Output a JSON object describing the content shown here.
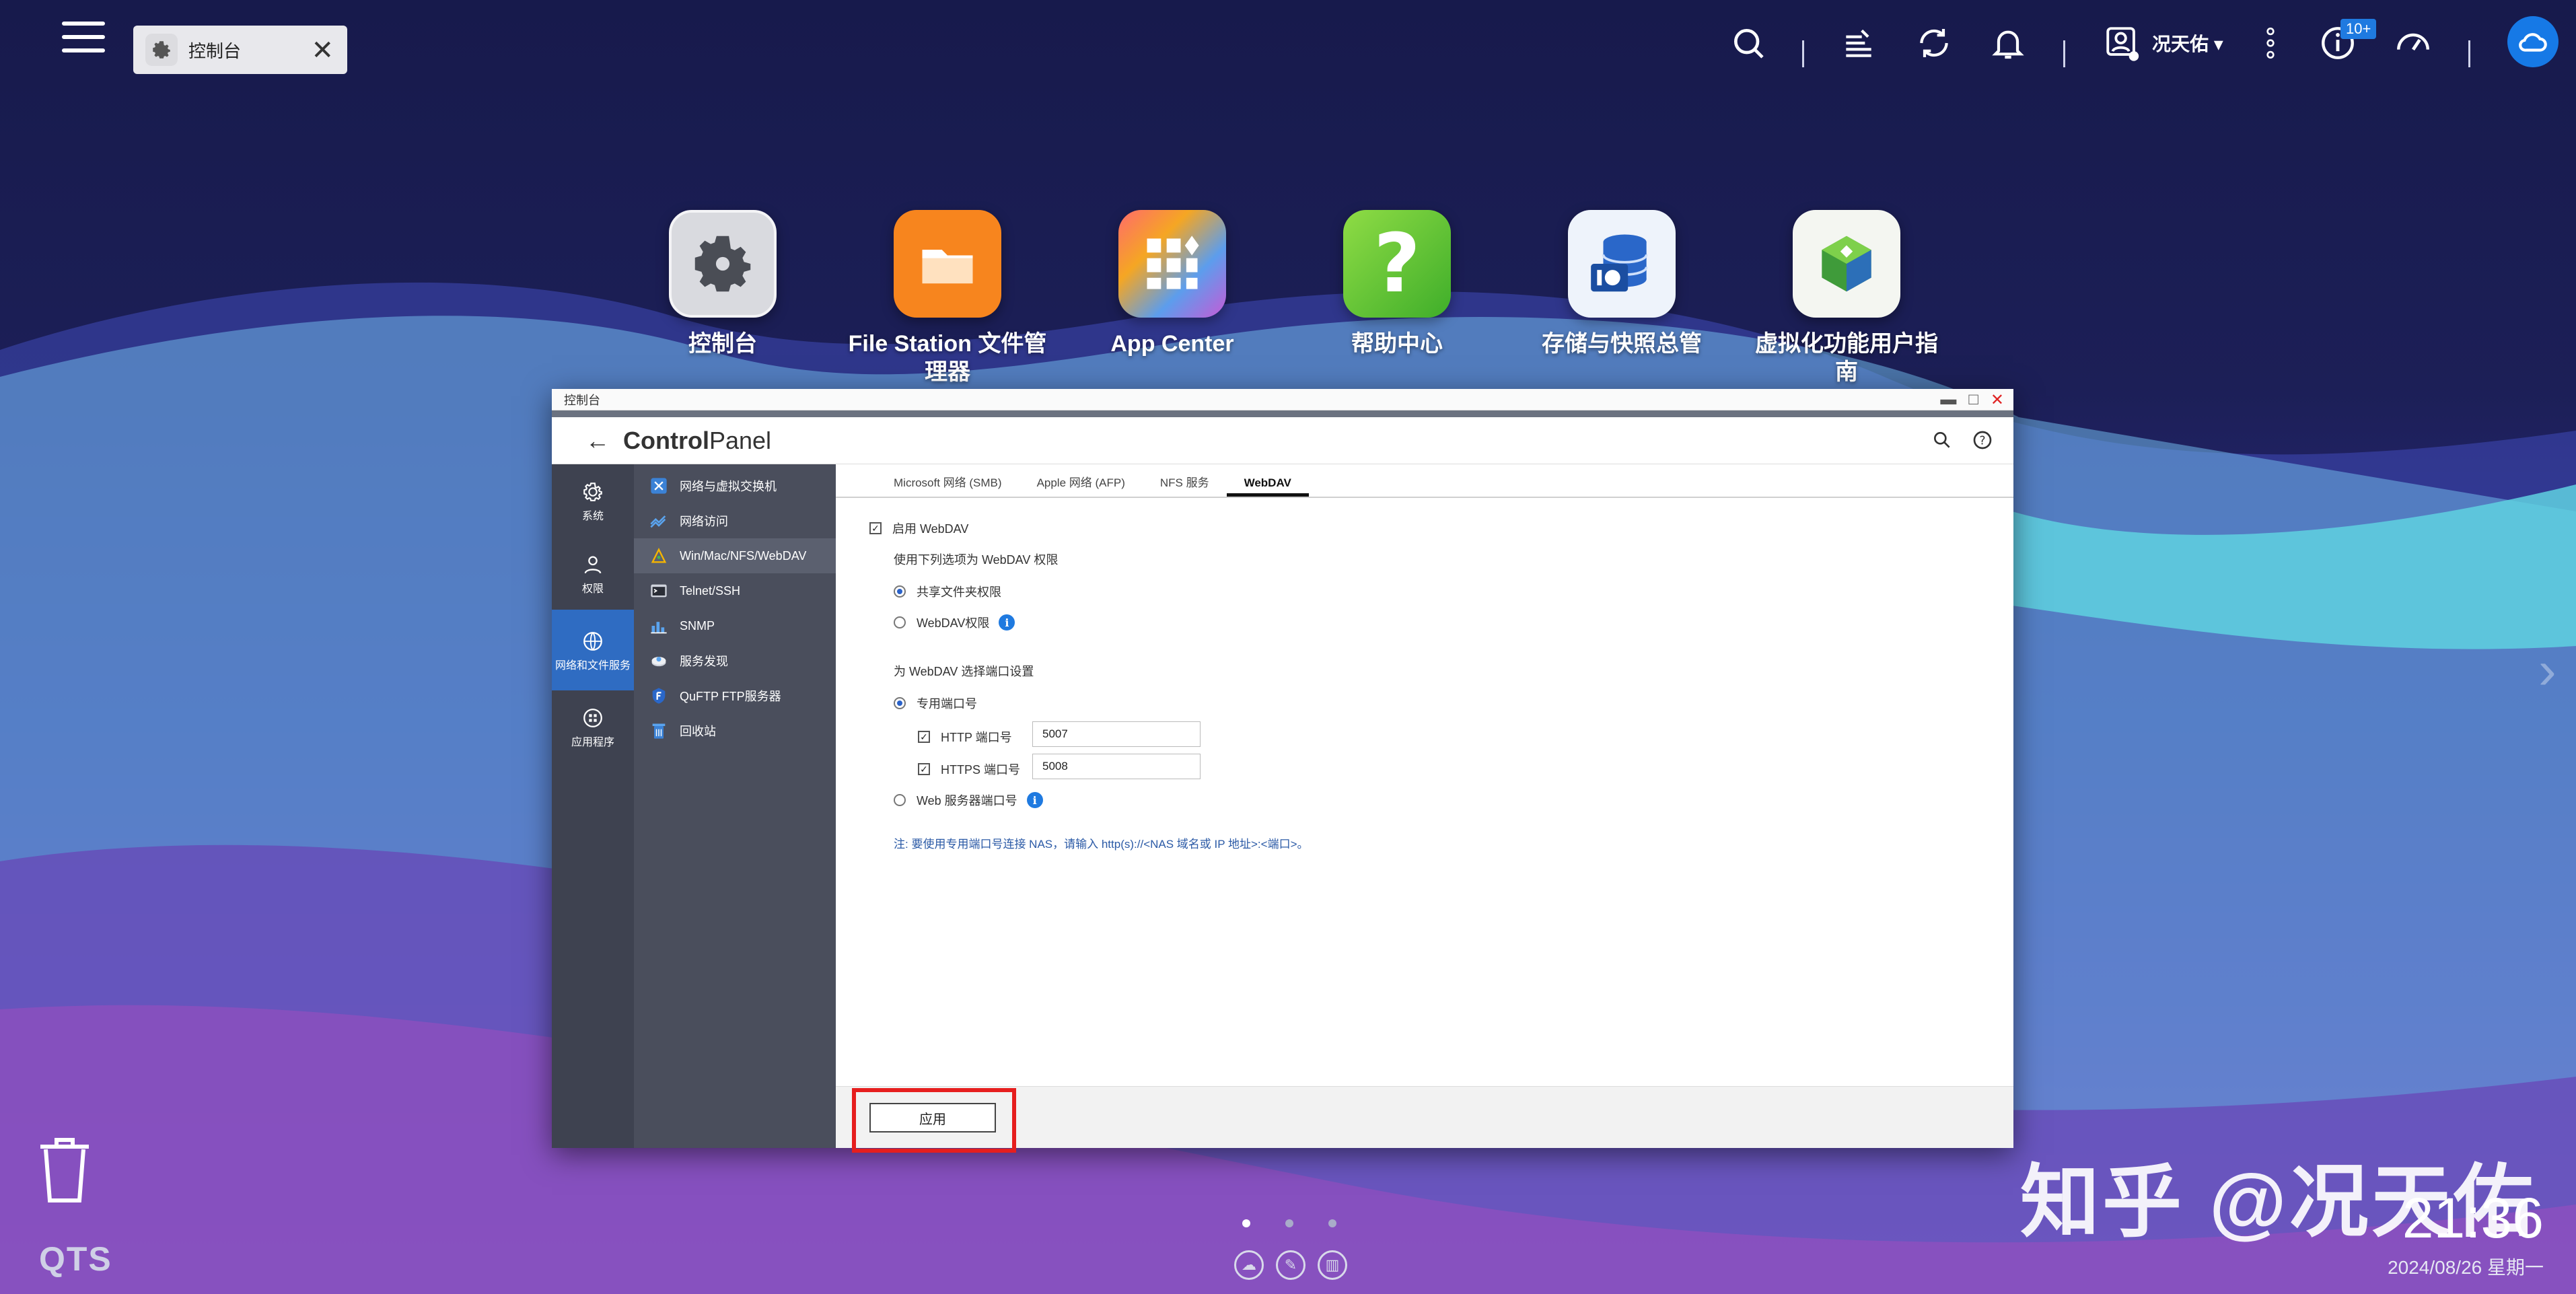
{
  "topbar": {
    "task_tab_label": "控制台",
    "user_name": "况天佑",
    "notification_badge": "10+"
  },
  "desktop_apps": [
    {
      "label": "控制台",
      "icon": "gear-icon"
    },
    {
      "label": "File Station 文件管理器",
      "icon": "folder-icon"
    },
    {
      "label": "App Center",
      "icon": "app-grid-icon"
    },
    {
      "label": "帮助中心",
      "icon": "help-icon"
    },
    {
      "label": "存储与快照总管",
      "icon": "storage-icon"
    },
    {
      "label": "虚拟化功能用户指南",
      "icon": "cube-icon"
    }
  ],
  "window": {
    "title": "控制台",
    "header_title_bold": "Control",
    "header_title_rest": "Panel"
  },
  "categories": [
    {
      "label": "系统",
      "icon": "gear-icon"
    },
    {
      "label": "权限",
      "icon": "user-icon"
    },
    {
      "label": "网络和文件服务",
      "icon": "globe-icon",
      "active": true
    },
    {
      "label": "应用程序",
      "icon": "apps-icon"
    }
  ],
  "sub_menu": [
    {
      "label": "网络与虚拟交换机",
      "icon": "network-switch-icon"
    },
    {
      "label": "网络访问",
      "icon": "network-access-icon"
    },
    {
      "label": "Win/Mac/NFS/WebDAV",
      "icon": "win-mac-icon",
      "active": true
    },
    {
      "label": "Telnet/SSH",
      "icon": "terminal-icon"
    },
    {
      "label": "SNMP",
      "icon": "snmp-icon"
    },
    {
      "label": "服务发现",
      "icon": "service-discovery-icon"
    },
    {
      "label": "QuFTP FTP服务器",
      "icon": "ftp-icon"
    },
    {
      "label": "回收站",
      "icon": "recycle-bin-icon"
    }
  ],
  "tabs": [
    {
      "label": "Microsoft 网络 (SMB)"
    },
    {
      "label": "Apple 网络 (AFP)"
    },
    {
      "label": "NFS 服务"
    },
    {
      "label": "WebDAV",
      "active": true
    }
  ],
  "form": {
    "enable_webdav": "启用 WebDAV",
    "permission_heading": "使用下列选项为 WebDAV 权限",
    "perm_shared_folder": "共享文件夹权限",
    "perm_webdav": "WebDAV权限",
    "port_heading": "为 WebDAV 选择端口设置",
    "port_dedicated": "专用端口号",
    "http_port_label": "HTTP 端口号",
    "http_port_value": "5007",
    "https_port_label": "HTTPS 端口号",
    "https_port_value": "5008",
    "port_web_server": "Web 服务器端口号",
    "note": "注: 要使用专用端口号连接 NAS，请输入 http(s)://<NAS 域名或 IP 地址>:<端口>。",
    "apply_label": "应用"
  },
  "bottom": {
    "qts_label": "QTS",
    "watermark": "知乎 @况天佑",
    "clock": "21:36",
    "date": "2024/08/26 星期一"
  }
}
